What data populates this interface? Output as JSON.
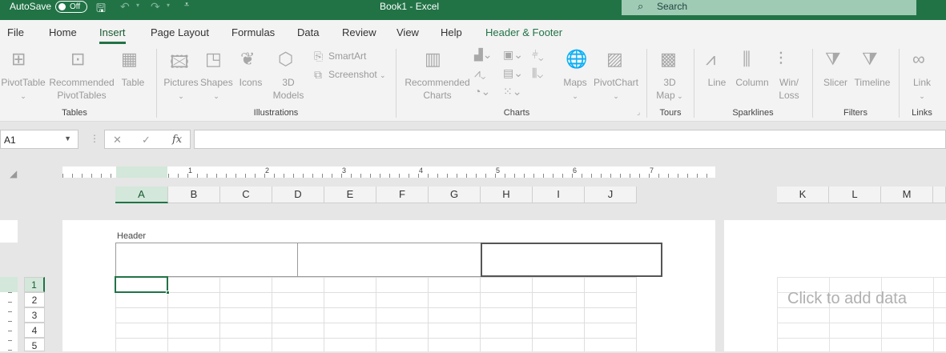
{
  "titlebar": {
    "autosave_label": "AutoSave",
    "autosave_state": "Off",
    "title": "Book1  -  Excel",
    "search_placeholder": "Search"
  },
  "tabs": [
    "File",
    "Home",
    "Insert",
    "Page Layout",
    "Formulas",
    "Data",
    "Review",
    "View",
    "Help",
    "Header & Footer"
  ],
  "ribbon": {
    "tables": {
      "pivottable": "PivotTable",
      "recommended_1": "Recommended",
      "recommended_2": "PivotTables",
      "table": "Table",
      "group": "Tables"
    },
    "illustrations": {
      "pictures": "Pictures",
      "shapes": "Shapes",
      "icons": "Icons",
      "models_1": "3D",
      "models_2": "Models",
      "smartart": "SmartArt",
      "screenshot": "Screenshot",
      "group": "Illustrations"
    },
    "charts": {
      "recommended_1": "Recommended",
      "recommended_2": "Charts",
      "maps": "Maps",
      "pivotchart": "PivotChart",
      "group": "Charts"
    },
    "tours": {
      "map_1": "3D",
      "map_2": "Map",
      "group": "Tours"
    },
    "sparklines": {
      "line": "Line",
      "column": "Column",
      "winloss_1": "Win/",
      "winloss_2": "Loss",
      "group": "Sparklines"
    },
    "filters": {
      "slicer": "Slicer",
      "timeline": "Timeline",
      "group": "Filters"
    },
    "links": {
      "link": "Link",
      "group": "Links"
    }
  },
  "formula_bar": {
    "name_box": "A1",
    "formula": ""
  },
  "ruler_numbers": [
    "1",
    "2",
    "3",
    "4",
    "5",
    "6",
    "7"
  ],
  "columns": [
    "A",
    "B",
    "C",
    "D",
    "E",
    "F",
    "G",
    "H",
    "I",
    "J"
  ],
  "columns_right": [
    "K",
    "L",
    "M"
  ],
  "rows": [
    "1",
    "2",
    "3",
    "4",
    "5"
  ],
  "page": {
    "header_label": "Header",
    "click_to_add": "Click to add data"
  },
  "colors": {
    "accent": "#217346",
    "ribbon_bg": "#f3f3f3"
  }
}
